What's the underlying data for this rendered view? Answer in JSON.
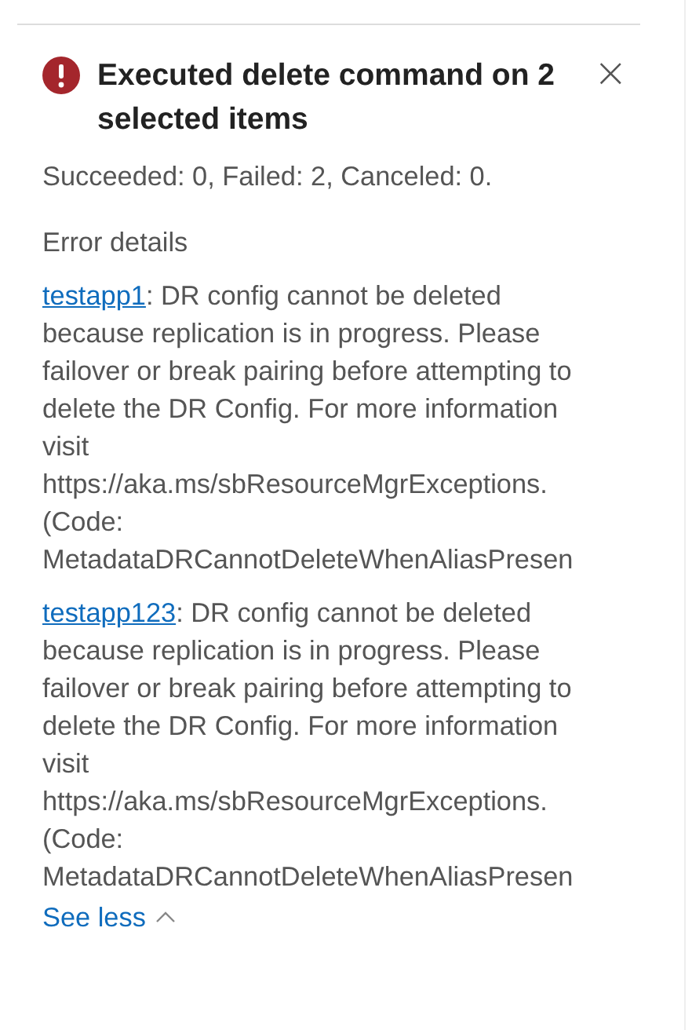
{
  "notification": {
    "kind": "error",
    "title": "Executed delete command on 2 selected items",
    "close_icon": "×",
    "summary": "Succeeded: 0, Failed: 2, Canceled: 0.",
    "details_heading": "Error details",
    "errors": [
      {
        "item": "testapp1",
        "message": ": DR config cannot be deleted because replication is in progress. Please failover or break pairing before attempting to delete the DR Config. For more information visit https://aka.ms/sbResourceMgrExceptions. (Code: MetadataDRCannotDeleteWhenAliasPresen"
      },
      {
        "item": "testapp123",
        "message": ": DR config cannot be deleted because replication is in progress. Please failover or break pairing before attempting to delete the DR Config. For more information visit https://aka.ms/sbResourceMgrExceptions. (Code: MetadataDRCannotDeleteWhenAliasPresen"
      }
    ],
    "toggle": {
      "label": "See less",
      "expanded": true
    }
  }
}
